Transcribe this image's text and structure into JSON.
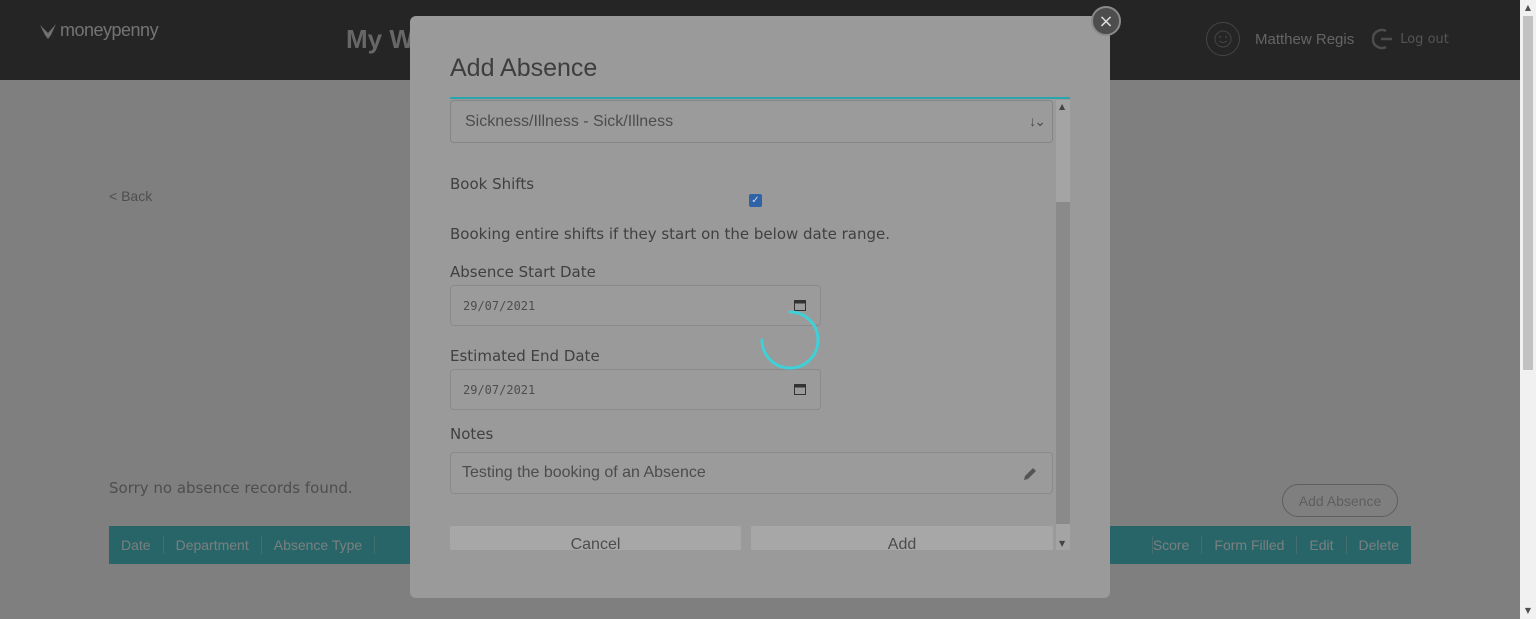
{
  "app": {
    "logo_text": "moneypenny",
    "page_heading": "My W",
    "user_name": "Matthew Regis",
    "logout_label": "Log out"
  },
  "page": {
    "back_label": "< Back",
    "no_records_text": "Sorry no absence records found.",
    "add_absence_label": "Add Absence",
    "table_headers_left": [
      "Date",
      "Department",
      "Absence Type"
    ],
    "table_headers_right": [
      "Score",
      "Form Filled",
      "Edit",
      "Delete"
    ],
    "accent_color": "#4ecbd3"
  },
  "modal": {
    "close_symbol": "×",
    "title": "Add Absence",
    "absence_type_value": "Sickness/Illness - Sick/Illness",
    "book_shifts_label": "Book Shifts",
    "book_shifts_checked": true,
    "hint_text": "Booking entire shifts if they start on the below date range.",
    "start_date_label": "Absence Start Date",
    "start_date_value": "29/07/2021",
    "end_date_label": "Estimated End Date",
    "end_date_value": "29/07/2021",
    "notes_label": "Notes",
    "notes_value": "Testing the booking of an Absence",
    "cancel_label": "Cancel",
    "add_label": "Add",
    "loading": true,
    "spinner_color": "#3fd0d8"
  }
}
